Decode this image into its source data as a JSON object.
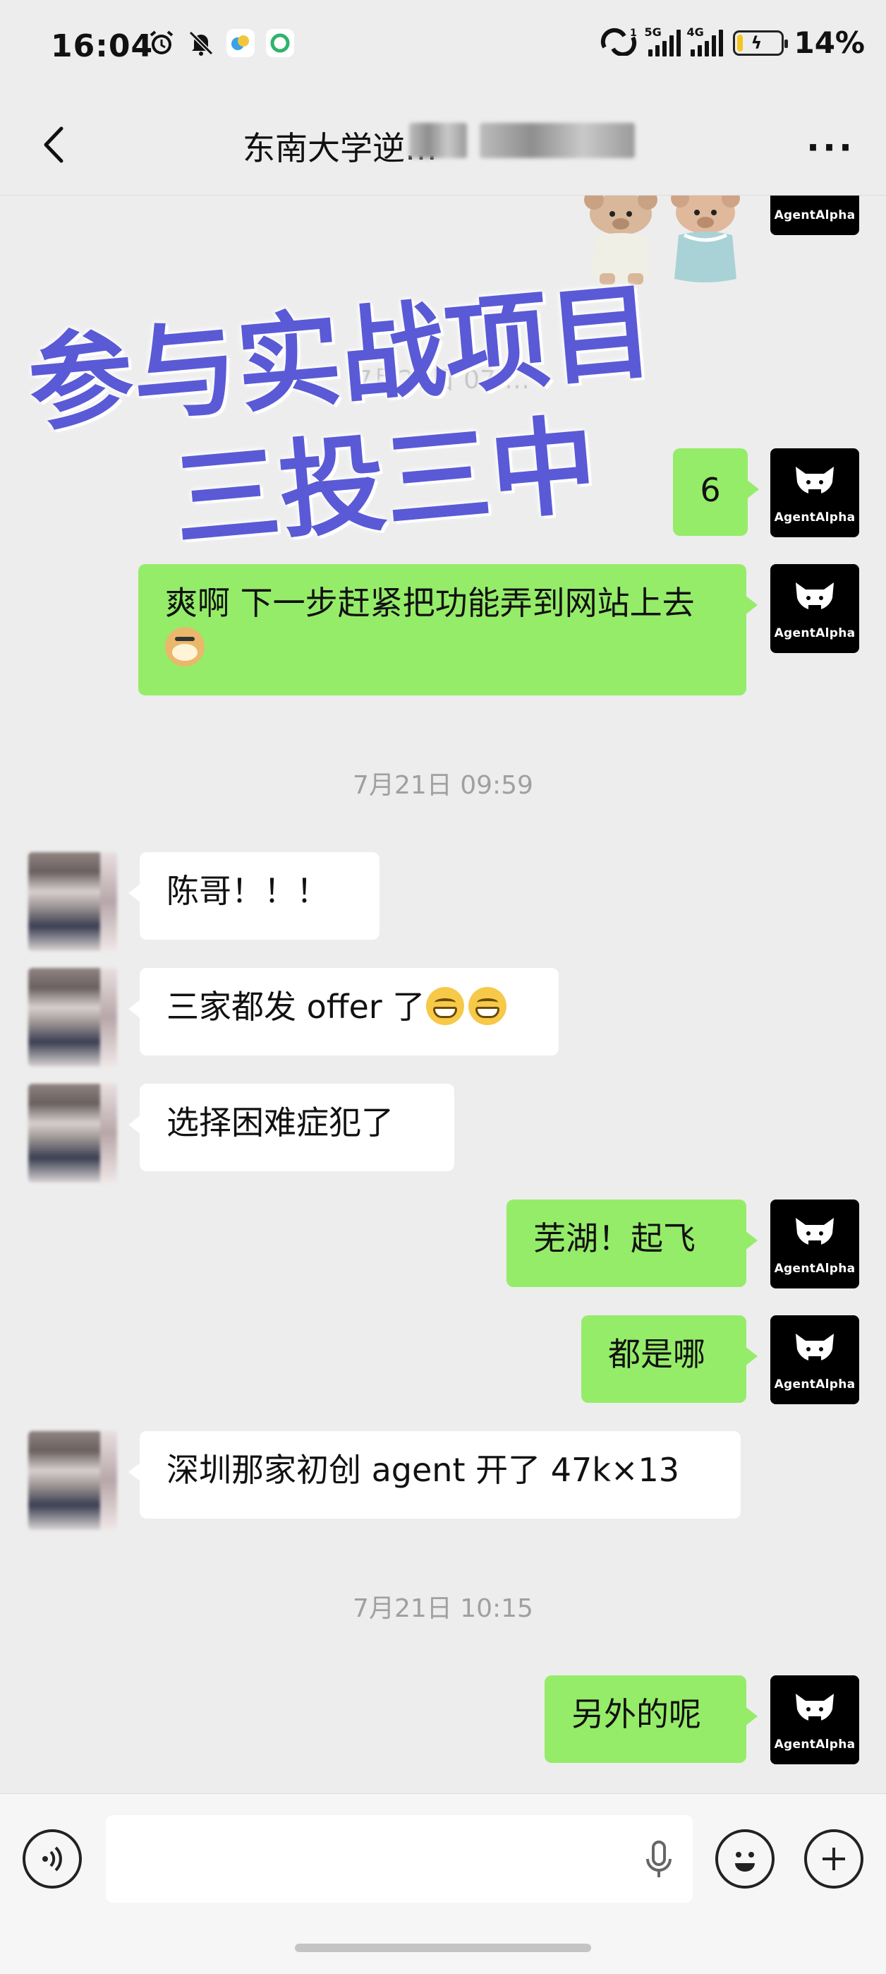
{
  "status_bar": {
    "time": "16:04",
    "signal1_tag": "5G",
    "signal2_tag": "4G",
    "battery_percent": "14%",
    "battery_level": 0.14
  },
  "nav": {
    "title": "东南大学逆…",
    "back_icon": "chevron-left-icon",
    "more_label": "···"
  },
  "overlay": {
    "line1": "参与实战项目",
    "line2": "三投三中"
  },
  "messages": [
    {
      "side": "me",
      "text": "6"
    },
    {
      "side": "me",
      "text": "爽啊 下一步赶紧把功能弄到网站上去"
    },
    {
      "type": "time",
      "text": "7月21日 09:59"
    },
    {
      "side": "them",
      "text": "陈哥！！！"
    },
    {
      "side": "them",
      "text": "三家都发 offer 了"
    },
    {
      "side": "them",
      "text": "选择困难症犯了"
    },
    {
      "side": "me",
      "text": "芜湖！起飞"
    },
    {
      "side": "me",
      "text": "都是哪"
    },
    {
      "side": "them",
      "text": "深圳那家初创 agent 开了 47k×13"
    },
    {
      "type": "time",
      "text": "7月21日 10:15"
    },
    {
      "side": "me",
      "text": "另外的呢"
    }
  ],
  "faded_time": "7月21日 07:…",
  "brand_avatar_label": "AgentAlpha",
  "colors": {
    "me_bubble": "#95ec69",
    "them_bubble": "#ffffff",
    "background": "#ededed",
    "overlay_text": "#5a5ad6"
  }
}
